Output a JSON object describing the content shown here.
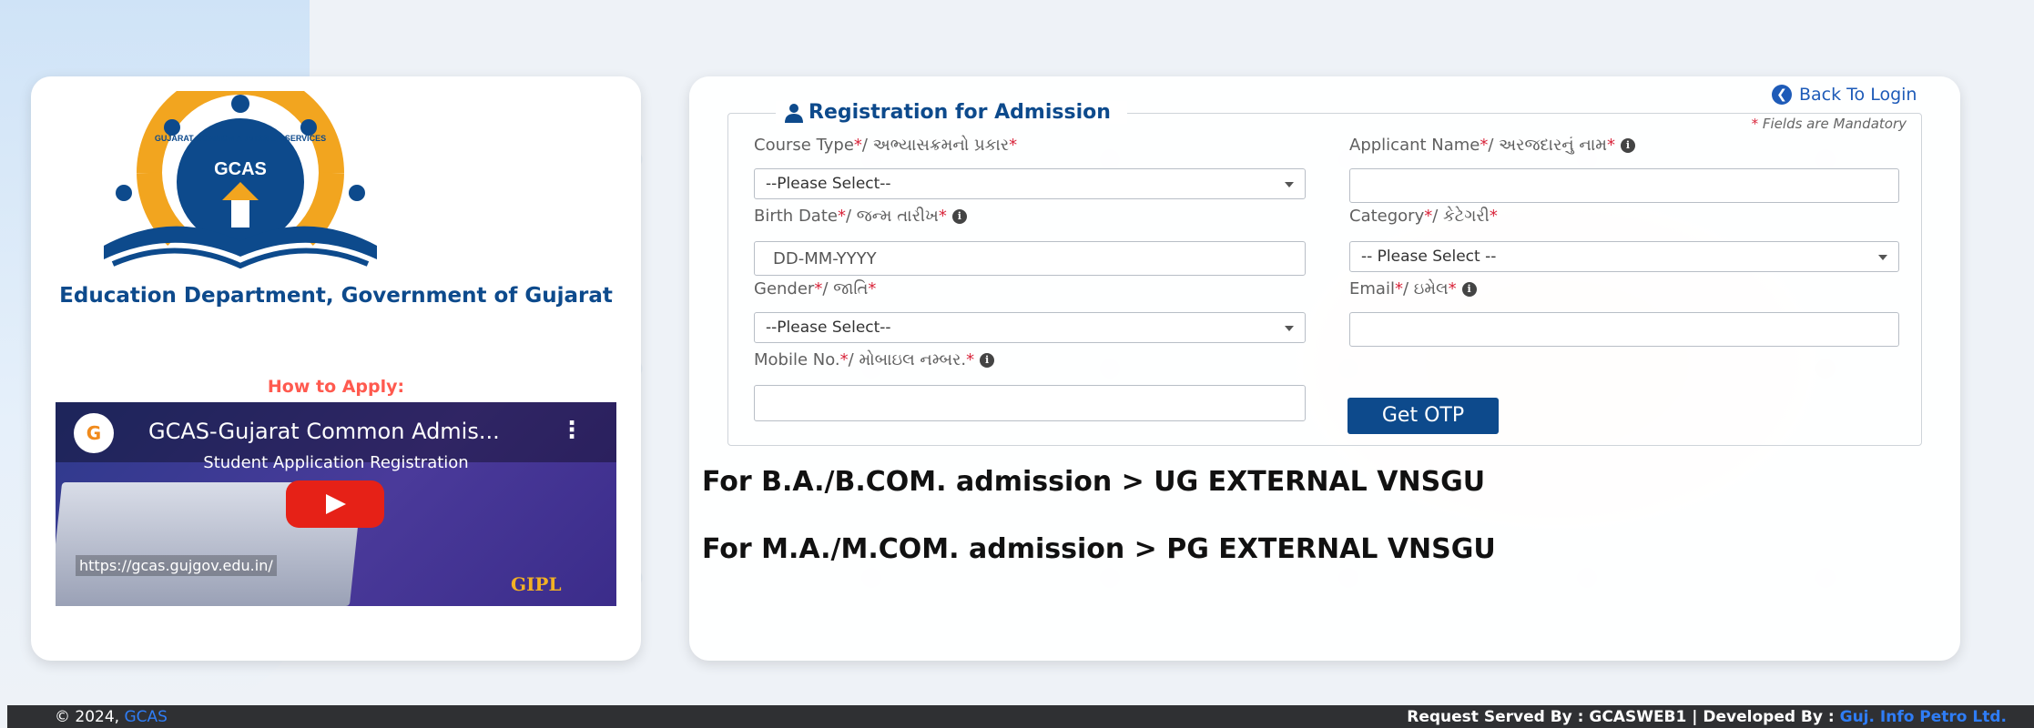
{
  "left": {
    "logo": {
      "top_arc": "GUJARAT COMMON ADMISSION SERVICES",
      "center": "GCAS"
    },
    "department": "Education Department, Government of Gujarat",
    "how_to_apply": "How to Apply:",
    "video": {
      "title": "GCAS-Gujarat Common Admis...",
      "subtitle": "Student Application Registration",
      "url": "https://gcas.gujgov.edu.in/",
      "brand": "GIPL"
    }
  },
  "form": {
    "legend": "Registration for Admission",
    "back_to_login": "Back To Login",
    "mandatory_note": "Fields are Mandatory",
    "fields": {
      "course_type": {
        "label": "Course Type",
        "label_gu": "/ અભ્યાસક્રમનો પ્રકાર",
        "value": "--Please Select--"
      },
      "applicant_name": {
        "label": "Applicant Name ",
        "label_gu": "/ અરજદારનું નામ",
        "value": ""
      },
      "birth_date": {
        "label": "Birth Date ",
        "label_gu": "/ જન્મ તારીખ ",
        "placeholder": "DD-MM-YYYY"
      },
      "category": {
        "label": "Category ",
        "label_gu": "/ કેટેગરી",
        "value": "-- Please Select --"
      },
      "gender": {
        "label": "Gender",
        "label_gu": "/ જાતિ",
        "value": "--Please Select--"
      },
      "email": {
        "label": "Email ",
        "label_gu": "/ ઇમેલ",
        "value": ""
      },
      "mobile": {
        "label": "Mobile No. ",
        "label_gu": "/ મોબાઇલ નમ્બર. ",
        "value": ""
      }
    },
    "get_otp": "Get OTP"
  },
  "notices": [
    "For B.A./B.COM. admission > UG EXTERNAL VNSGU",
    "For M.A./M.COM. admission > PG EXTERNAL VNSGU"
  ],
  "footer": {
    "copyright": "© 2024, ",
    "gcas_link": "GCAS",
    "served_by": "Request Served By : GCASWEB1 | Developed By : ",
    "developer_link": "Guj. Info Petro Ltd."
  },
  "colors": {
    "primary": "#0d4a8c",
    "required": "#d9263c",
    "link": "#2f7df6",
    "how_to": "#ff5a4f"
  }
}
